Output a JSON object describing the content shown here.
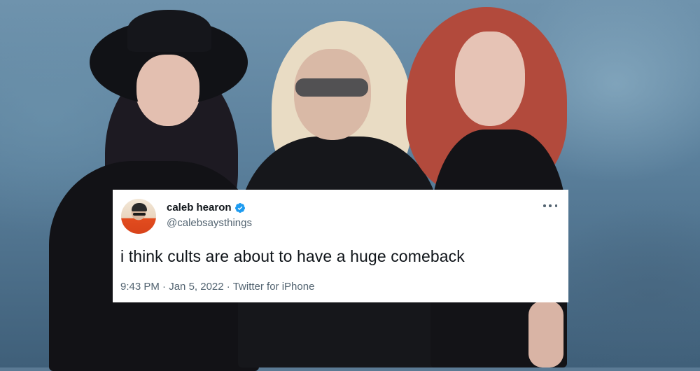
{
  "tweet": {
    "display_name": "caleb hearon",
    "handle": "@calebsaysthings",
    "text": "i think cults are about to have a huge comeback",
    "time": "9:43 PM",
    "separator": "·",
    "date": "Jan 5, 2022",
    "source": "Twitter for iPhone",
    "verified": true,
    "avatar_icon": "user-avatar",
    "more_icon": "more-horizontal-icon",
    "verified_icon": "verified-badge-icon"
  },
  "colors": {
    "card_bg": "#ffffff",
    "text_primary": "#0f1419",
    "text_secondary": "#536471",
    "verified_blue": "#1d9bf0"
  }
}
